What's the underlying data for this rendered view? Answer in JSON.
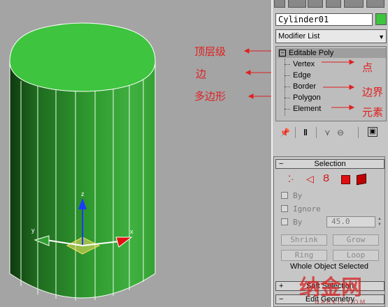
{
  "viewport": {
    "object_color": "#3ec43e",
    "axis_labels": {
      "z": "z",
      "x": "x",
      "y": "y"
    },
    "annotations": [
      {
        "text": "顶层级"
      },
      {
        "text": "边"
      },
      {
        "text": "多边形"
      },
      {
        "text": "点"
      },
      {
        "text": "边界"
      },
      {
        "text": "元素"
      }
    ]
  },
  "panel": {
    "object_name": "Cylinder01",
    "object_color": "#3ec43e",
    "modifier_list_label": "Modifier List",
    "stack": {
      "root": {
        "expander": "−",
        "label": "Editable Poly"
      },
      "items": [
        "Vertex",
        "Edge",
        "Border",
        "Polygon",
        "Element"
      ]
    },
    "stack_toolbar_icons": [
      "pin-stack-icon",
      "show-end-result-icon",
      "make-unique-icon",
      "remove-modifier-icon",
      "configure-modifier-sets-icon"
    ],
    "selection": {
      "header": "Selection",
      "toggle": "−",
      "subobject_icons": [
        "vertex-icon",
        "edge-icon",
        "border-icon",
        "polygon-icon",
        "element-icon"
      ],
      "by_vertex_label": "By",
      "ignore_backfacing_label": "Ignore",
      "by_angle_label": "By",
      "angle_value": "45.0",
      "shrink_label": "Shrink",
      "grow_label": "Grow",
      "ring_label": "Ring",
      "loop_label": "Loop",
      "status_text": "Whole Object Selected"
    },
    "rollout_2": {
      "toggle": "+",
      "label": "Soft Selection"
    },
    "rollout_3": {
      "toggle": "−",
      "label": "Edit Geometry"
    }
  },
  "watermark": {
    "text": "纳金网",
    "subtext": "NARKII.COM"
  }
}
